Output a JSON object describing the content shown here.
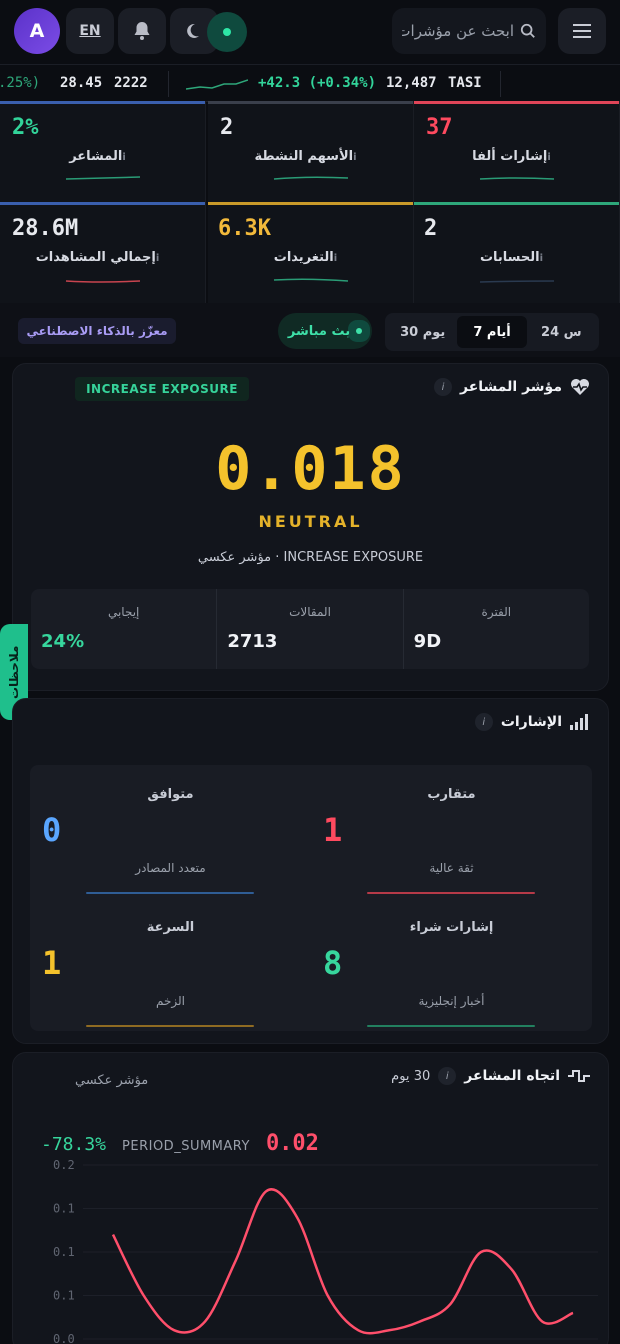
{
  "header": {
    "avatar_letter": "A",
    "lang": "EN",
    "search_placeholder": "ابحث عن مؤشرات"
  },
  "ticker": {
    "partial_change": ".25%)",
    "item1_price": "28.45",
    "item1_symbol": "2222",
    "tasi_change": "+42.3 (+0.34%)",
    "tasi_value": "12,487",
    "tasi_symbol": "TASI"
  },
  "stats": [
    {
      "value": "37",
      "label": "إشارات ألفا",
      "color": "#ff4a5f"
    },
    {
      "value": "2",
      "label": "الأسهم النشطة",
      "color": "#ffffff"
    },
    {
      "value": "2%",
      "label": "المشاعر",
      "color": "#32d49a"
    },
    {
      "value": "2",
      "label": "الحسابات",
      "color": "#ffffff"
    },
    {
      "value": "6.3K",
      "label": "التغريدات",
      "color": "#f2b93b"
    },
    {
      "value": "28.6M",
      "label": "إجمالي المشاهدات",
      "color": "#ffffff"
    }
  ],
  "filters": {
    "ai_badge": "معزّز بالذكاء الاصطناعي",
    "live": "بث مباشر",
    "ranges": [
      "24 س",
      "7 أيام",
      "30 يوم"
    ],
    "active_range": "7 أيام"
  },
  "sentiment": {
    "title": "مؤشر المشاعر",
    "badge": "INCREASE EXPOSURE",
    "score": "0.018",
    "state": "NEUTRAL",
    "note": "مؤشر عكسي · INCREASE EXPOSURE",
    "kpis": [
      {
        "label": "الفترة",
        "value": "9D"
      },
      {
        "label": "المقالات",
        "value": "2713"
      },
      {
        "label": "إيجابي",
        "value": "24%"
      }
    ]
  },
  "notes_tab": "ملاحظات",
  "signals": {
    "title": "الإشارات",
    "items": [
      {
        "title": "متقارب",
        "value": "1",
        "sub": "ثقة عالية",
        "color": "#ff4a5f"
      },
      {
        "title": "متوافق",
        "value": "0",
        "sub": "متعدد المصادر",
        "color": "#5aa6ff"
      },
      {
        "title": "إشارات شراء",
        "value": "8",
        "sub": "أخبار إنجليزية",
        "color": "#37d69d"
      },
      {
        "title": "السرعة",
        "value": "1",
        "sub": "الزخم",
        "color": "#f4c22c"
      }
    ]
  },
  "trend": {
    "title": "اتجاه المشاعر",
    "range": "30 يوم",
    "subtitle": "مؤشر عكسي",
    "pct": "-78.3%",
    "summary_label": "PERIOD_SUMMARY",
    "summary_value": "0.02"
  },
  "chart_data": {
    "type": "line",
    "ylim": [
      0.0,
      0.2
    ],
    "y_ticks": [
      "0.2",
      "0.1",
      "0.1",
      "0.1",
      "0.0"
    ],
    "series": [
      {
        "values": [
          0.12,
          0.05,
          0.01,
          0.02,
          0.09,
          0.17,
          0.14,
          0.05,
          0.01,
          0.01,
          0.02,
          0.04,
          0.1,
          0.08,
          0.02,
          0.03
        ]
      }
    ],
    "line_color": "#ff4f6b"
  }
}
